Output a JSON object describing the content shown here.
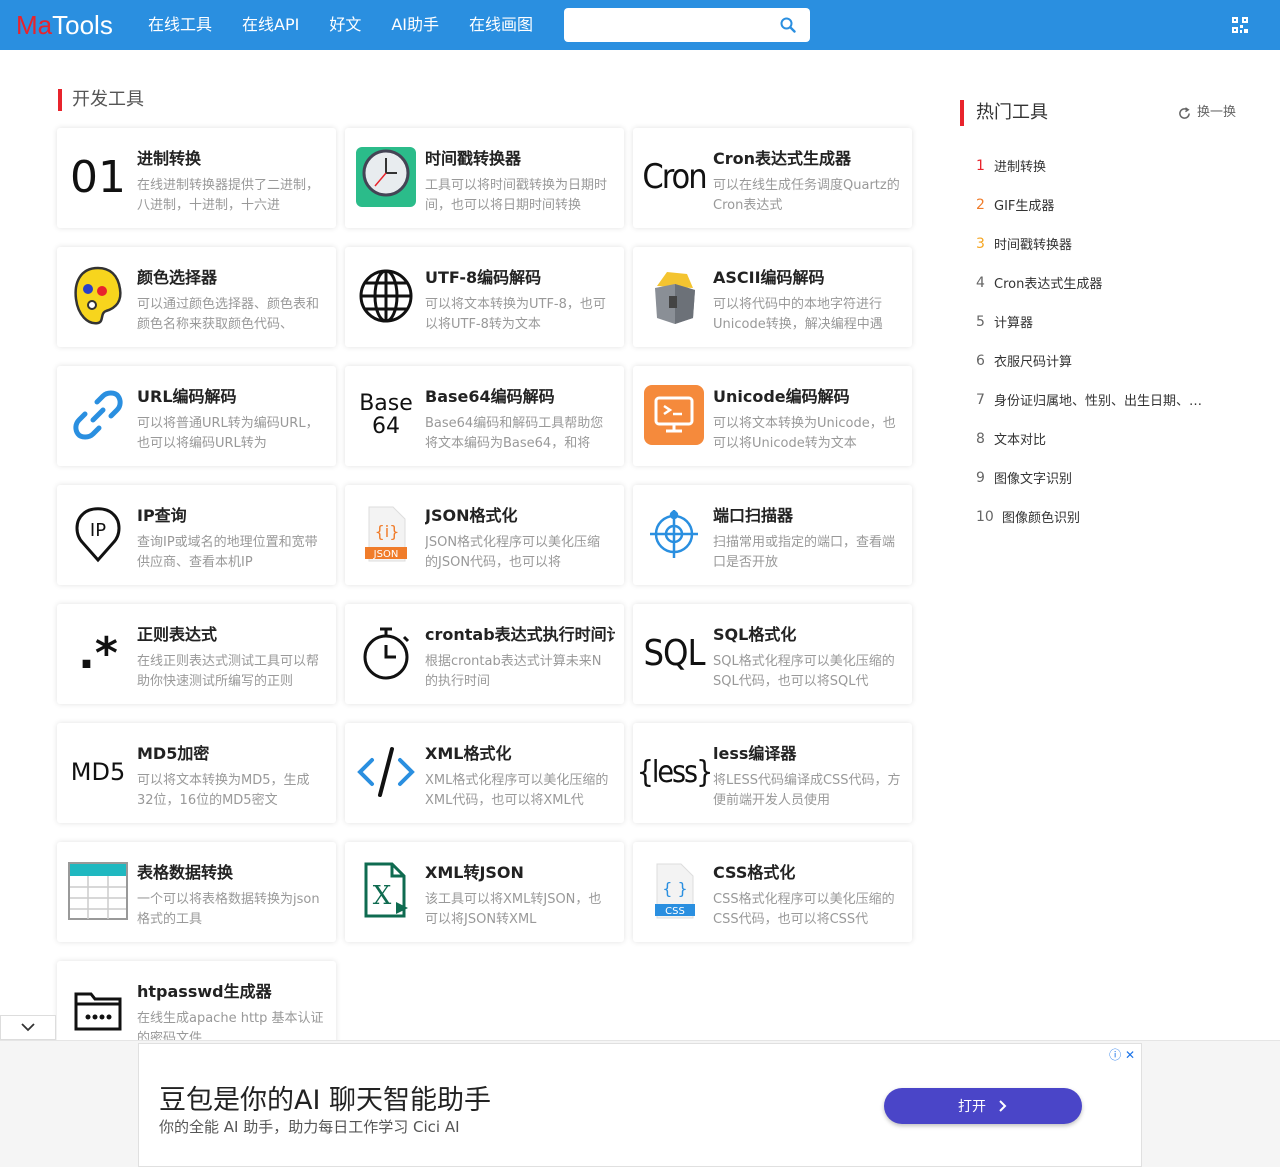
{
  "logo": {
    "ma": "Ma",
    "tools": "Tools"
  },
  "nav": [
    "在线工具",
    "在线API",
    "好文",
    "AI助手",
    "在线画图"
  ],
  "search": {
    "placeholder": ""
  },
  "section_title": "开发工具",
  "cards": [
    {
      "name": "进制转换",
      "desc": "在线进制转换器提供了二进制，八进制，十进制，十六进",
      "icon": "text-01-icon",
      "icon_text": "01"
    },
    {
      "name": "时间戳转换器",
      "desc": "工具可以将时间戳转换为日期时间，也可以将日期时间转换",
      "icon": "clock-icon"
    },
    {
      "name": "Cron表达式生成器",
      "desc": "可以在线生成任务调度Quartz的Cron表达式",
      "icon": "cron-text-icon",
      "icon_text": "Cron"
    },
    {
      "name": "颜色选择器",
      "desc": "可以通过颜色选择器、颜色表和颜色名称来获取颜色代码、",
      "icon": "palette-icon"
    },
    {
      "name": "UTF-8编码解码",
      "desc": "可以将文本转换为UTF-8，也可以将UTF-8转为文本",
      "icon": "globe-icon"
    },
    {
      "name": "ASCII编码解码",
      "desc": "可以将代码中的本地字符进行Unicode转换，解决编程中遇",
      "icon": "lock-box-icon"
    },
    {
      "name": "URL编码解码",
      "desc": "可以将普通URL转为编码URL，也可以将编码URL转为",
      "icon": "link-icon"
    },
    {
      "name": "Base64编码解码",
      "desc": "Base64编码和解码工具帮助您将文本编码为Base64，和将",
      "icon": "base64-text-icon",
      "icon_text": "Base",
      "icon_text2": "64"
    },
    {
      "name": "Unicode编码解码",
      "desc": "可以将文本转换为Unicode，也可以将Unicode转为文本",
      "icon": "monitor-icon"
    },
    {
      "name": "IP查询",
      "desc": "查询IP或域名的地理位置和宽带供应商、查看本机IP",
      "icon": "ip-pin-icon"
    },
    {
      "name": "JSON格式化",
      "desc": "JSON格式化程序可以美化压缩的JSON代码，也可以将",
      "icon": "json-file-icon",
      "icon_text": "JSON"
    },
    {
      "name": "端口扫描器",
      "desc": "扫描常用或指定的端口，查看端口是否开放",
      "icon": "crosshair-icon"
    },
    {
      "name": "正则表达式",
      "desc": "在线正则表达式测试工具可以帮助你快速测试所编写的正则",
      "icon": "regex-icon",
      "icon_text": ".*"
    },
    {
      "name": "crontab表达式执行时间计",
      "desc": "根据crontab表达式计算未来N的执行时间",
      "icon": "stopwatch-icon"
    },
    {
      "name": "SQL格式化",
      "desc": "SQL格式化程序可以美化压缩的SQL代码，也可以将SQL代",
      "icon": "sql-text-icon",
      "icon_text": "SQL"
    },
    {
      "name": "MD5加密",
      "desc": "可以将文本转换为MD5，生成32位，16位的MD5密文",
      "icon": "md5-text-icon",
      "icon_text": "MD5"
    },
    {
      "name": "XML格式化",
      "desc": "XML格式化程序可以美化压缩的XML代码，也可以将XML代",
      "icon": "code-icon"
    },
    {
      "name": "less编译器",
      "desc": "将LESS代码编译成CSS代码，方便前端开发人员使用",
      "icon": "less-text-icon",
      "icon_text": "{less}"
    },
    {
      "name": "表格数据转换",
      "desc": "一个可以将表格数据转换为json格式的工具",
      "icon": "table-icon"
    },
    {
      "name": "XML转JSON",
      "desc": "该工具可以将XML转JSON，也可以将JSON转XML",
      "icon": "xml-file-icon"
    },
    {
      "name": "CSS格式化",
      "desc": "CSS格式化程序可以美化压缩的CSS代码，也可以将CSS代",
      "icon": "css-file-icon",
      "icon_text": "CSS"
    },
    {
      "name": "htpasswd生成器",
      "desc": "在线生成apache http 基本认证的密码文件",
      "icon": "folder-password-icon"
    }
  ],
  "sidebar": {
    "title": "热门工具",
    "refresh": "换一换",
    "items": [
      {
        "num": "1",
        "label": "进制转换",
        "color": "#e8242c"
      },
      {
        "num": "2",
        "label": "GIF生成器",
        "color": "#f07c2a"
      },
      {
        "num": "3",
        "label": "时间戳转换器",
        "color": "#f5a623"
      },
      {
        "num": "4",
        "label": "Cron表达式生成器"
      },
      {
        "num": "5",
        "label": "计算器"
      },
      {
        "num": "6",
        "label": "衣服尺码计算"
      },
      {
        "num": "7",
        "label": "身份证归属地、性别、出生日期、…"
      },
      {
        "num": "8",
        "label": "文本对比"
      },
      {
        "num": "9",
        "label": "图像文字识别"
      },
      {
        "num": "10",
        "label": "图像颜色识别"
      }
    ]
  },
  "ad": {
    "title": "豆包是你的AI 聊天智能助手",
    "subtitle": "你的全能 AI 助手，助力每日工作学习 Cici AI",
    "button": "打开",
    "close": "ⓘ ✕"
  },
  "colors": {
    "header": "#2a8fe0",
    "accent": "#e8242c",
    "ad_button": "#4a45c8"
  }
}
